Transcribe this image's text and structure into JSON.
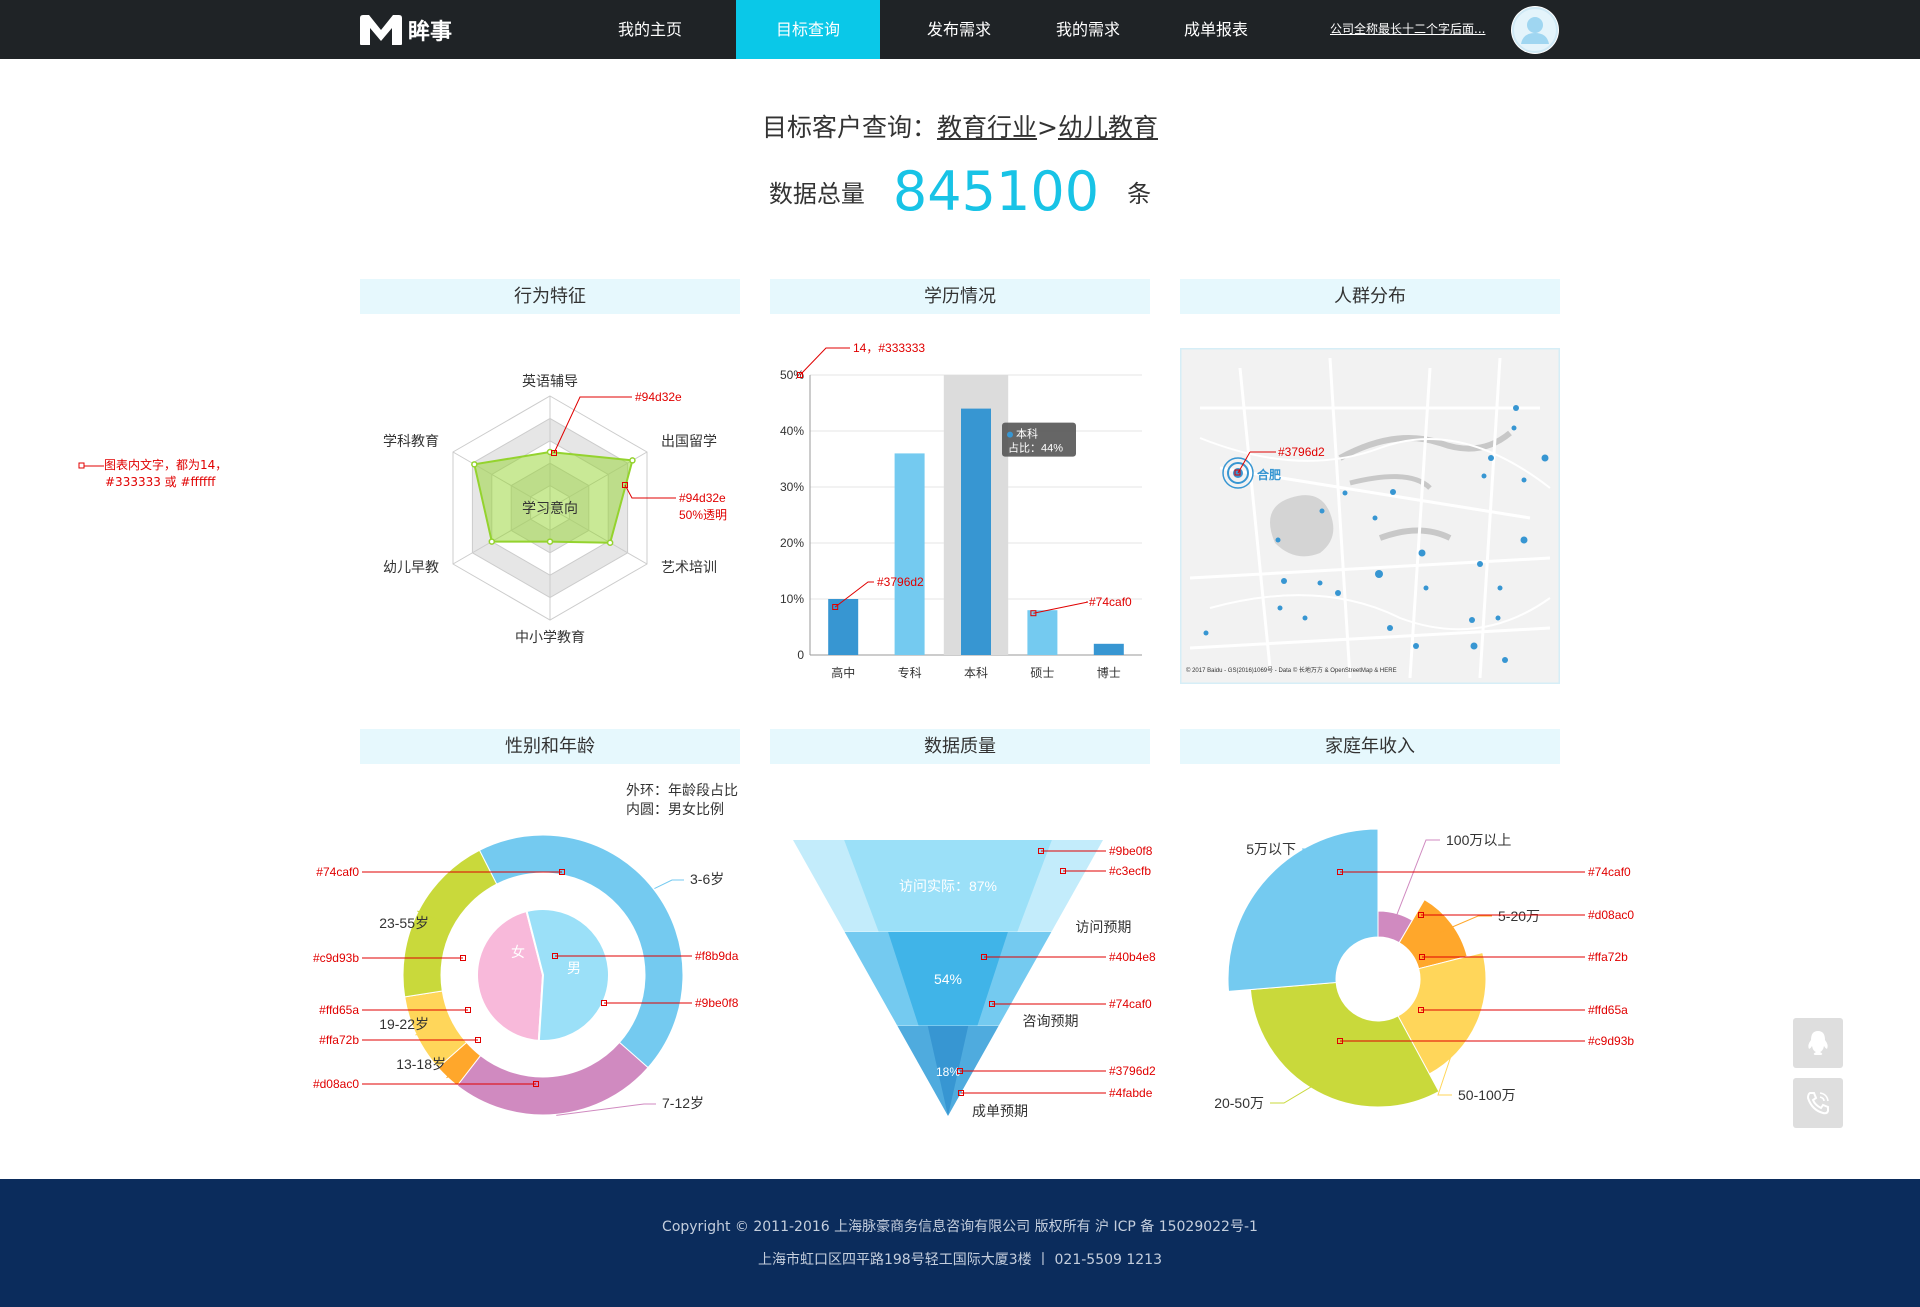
{
  "brand": {
    "logo_text": "眸事",
    "accent_color": "#0ac8e8",
    "nav_bg": "#1f2326"
  },
  "nav": {
    "items": [
      {
        "label": "我的主页",
        "active": false
      },
      {
        "label": "目标查询",
        "active": true
      },
      {
        "label": "发布需求",
        "active": false
      },
      {
        "label": "我的需求",
        "active": false
      },
      {
        "label": "成单报表",
        "active": false
      }
    ],
    "company": "公司全称最长十二个字后面...",
    "avatar_icon": "user-avatar-icon"
  },
  "heading": {
    "prefix": "目标客户查询：",
    "industry": "教育行业",
    "separator": ">",
    "sub_industry": "幼儿教育",
    "total_label": "数据总量",
    "total_value": "845100",
    "total_unit": "条"
  },
  "panels": {
    "behavior": "行为特征",
    "education": "学历情况",
    "population": "人群分布",
    "gender_age": "性别和年龄",
    "quality": "数据质量",
    "income": "家庭年收入"
  },
  "spec_note": {
    "line1": "图表内文字，都为14，",
    "line2": "#333333  或 #ffffff"
  },
  "chart_data": [
    {
      "type": "radar",
      "center_label": "学习意向",
      "axes": [
        "英语辅导",
        "出国留学",
        "艺术培训",
        "中小学教育",
        "幼儿早教",
        "学科教育"
      ],
      "values": [
        0.5,
        0.85,
        0.62,
        0.3,
        0.6,
        0.78
      ],
      "max": 1,
      "color": "#94d32e",
      "annotations": [
        "#94d32e",
        "#94d32e",
        "50%透明"
      ]
    },
    {
      "type": "bar",
      "categories": [
        "高中",
        "专科",
        "本科",
        "硕士",
        "博士"
      ],
      "values": [
        10,
        36,
        44,
        8,
        2
      ],
      "colors": [
        "#3796d2",
        "#74caf0",
        "#3796d2",
        "#74caf0",
        "#3796d2"
      ],
      "ylim": [
        0,
        50
      ],
      "yticks": [
        "0",
        "10%",
        "20%",
        "30%",
        "40%",
        "50%"
      ],
      "highlight_index": 2,
      "tooltip": {
        "series": "本科",
        "text": "占比：44%"
      },
      "annotations": [
        "14，#333333",
        "#3796d2",
        "#74caf0"
      ]
    },
    {
      "type": "map",
      "city": "合肥",
      "annotation": "#3796d2",
      "attribution": "© 2017 Baidu - GS(2016)1069号 - Data © 长地万方 & OpenStreetMap & HERE"
    },
    {
      "type": "pie",
      "legend_lines": [
        "外环：年龄段占比",
        "内圆：男女比例"
      ],
      "inner": [
        {
          "name": "女",
          "value": 45,
          "color": "#f8b9da"
        },
        {
          "name": "男",
          "value": 55,
          "color": "#9be0f8"
        }
      ],
      "outer": [
        {
          "name": "3-6岁",
          "value": 44,
          "color": "#74caf0"
        },
        {
          "name": "7-12岁",
          "value": 24,
          "color": "#d08ac0"
        },
        {
          "name": "13-18岁",
          "value": 3,
          "color": "#ffa72b"
        },
        {
          "name": "19-22岁",
          "value": 9,
          "color": "#ffd65a"
        },
        {
          "name": "23-55岁",
          "value": 20,
          "color": "#c9d93b"
        }
      ],
      "annotations": [
        "#74caf0",
        "#c9d93b",
        "#ffd65a",
        "#ffa72b",
        "#d08ac0",
        "#f8b9da",
        "#9be0f8"
      ]
    },
    {
      "type": "funnel",
      "stages": [
        {
          "name": "访问预期",
          "label": "访问实际：87%",
          "value": 87,
          "color": "#9be0f8",
          "outer_color": "#c3ecfb"
        },
        {
          "name": "咨询预期",
          "label": "54%",
          "value": 54,
          "color": "#40b4e8",
          "outer_color": "#74caf0"
        },
        {
          "name": "成单预期",
          "label": "18%",
          "value": 18,
          "color": "#3796d2",
          "outer_color": "#4fabde"
        }
      ],
      "annotations": [
        "#9be0f8",
        "#c3ecfb",
        "#40b4e8",
        "#74caf0",
        "#3796d2",
        "#4fabde"
      ]
    },
    {
      "type": "pie",
      "variant": "rose",
      "series": [
        {
          "name": "100万以上",
          "value": 8,
          "color": "#d08ac0"
        },
        {
          "name": "5-20万",
          "value": 12,
          "color": "#ffa72b"
        },
        {
          "name": "50-100万",
          "value": 20,
          "color": "#ffd65a"
        },
        {
          "name": "20-50万",
          "value": 30,
          "color": "#c9d93b"
        },
        {
          "name": "5万以下",
          "value": 25,
          "color": "#74caf0"
        }
      ],
      "annotations": [
        "#74caf0",
        "#d08ac0",
        "#ffa72b",
        "#ffd65a",
        "#c9d93b"
      ]
    }
  ],
  "side_buttons": [
    "qq-icon",
    "phone-icon"
  ],
  "footer": {
    "line1": "Copyright  ©    2011-2016 上海脉豪商务信息咨询有限公司  版权所有  沪 ICP 备 15029022号-1",
    "line2": "上海市虹口区四平路198号轻工国际大厦3楼  丨  021-5509 1213"
  }
}
